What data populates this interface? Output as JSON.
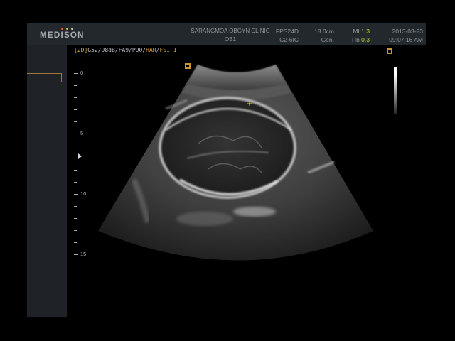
{
  "header": {
    "logo": "MEDISON",
    "logo_dots": [
      "#e45b3a",
      "#e2b832",
      "#c9c9c9"
    ],
    "clinic_name": "SARANGMOA OBGYN CLINIC",
    "exam": "OB1",
    "frame_rate": "FPS24D",
    "probe": "C2-6IC",
    "depth": "18.0cm",
    "freq_mode": "Gen.",
    "mi_label": "MI",
    "mi_value": "1.3",
    "tib_label": "TIb",
    "tib_value": "0.3",
    "date": "2013-03-23",
    "time": "09:07:16 AM"
  },
  "mode": {
    "prefix": "[2D]",
    "params": "G52/98dB/FA9/P90/",
    "har": "HAR",
    "sep": "/",
    "fsi": "FSI 1"
  },
  "depth_scale": {
    "labels": [
      "0",
      "5",
      "10",
      "15"
    ]
  },
  "colors": {
    "accent_orange": "#c8962e",
    "value_green": "#b8d62f",
    "header_bg": "#23282d",
    "panel_bg": "#1f2327"
  },
  "icons": [
    "focus-marker-icon",
    "orientation-marker-icon",
    "caliper-cross-icon"
  ]
}
